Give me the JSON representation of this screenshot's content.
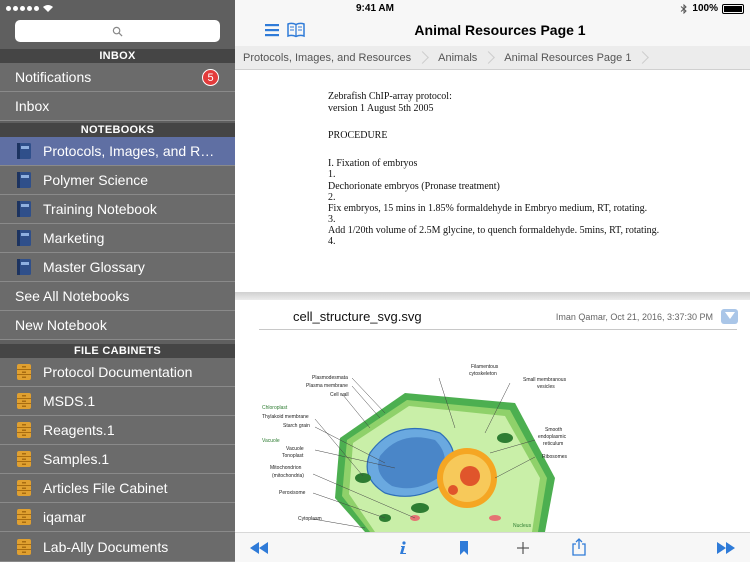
{
  "status": {
    "time": "9:41 AM",
    "battery": "100%"
  },
  "sidebar": {
    "inbox_header": "INBOX",
    "inbox_items": [
      {
        "label": "Notifications",
        "badge": "5"
      },
      {
        "label": "Inbox"
      }
    ],
    "notebooks_header": "NOTEBOOKS",
    "notebooks": [
      {
        "label": "Protocols, Images, and Resources",
        "selected": true
      },
      {
        "label": "Polymer Science"
      },
      {
        "label": "Training Notebook"
      },
      {
        "label": "Marketing"
      },
      {
        "label": "Master Glossary"
      }
    ],
    "notebook_actions": [
      "See All Notebooks",
      "New Notebook"
    ],
    "file_cabinets_header": "FILE CABINETS",
    "file_cabinets": [
      "Protocol Documentation",
      "MSDS.1",
      "Reagents.1",
      "Samples.1",
      "Articles File Cabinet",
      "iqamar",
      "Lab-Ally Documents"
    ]
  },
  "header": {
    "title": "Animal Resources Page 1"
  },
  "breadcrumb": [
    "Protocols, Images, and Resources",
    "Animals",
    "Animal Resources Page 1"
  ],
  "document": {
    "lines": [
      "Zebrafish ChIP-array protocol:",
      "version 1 August 5th 2005",
      "PROCEDURE",
      "I. Fixation of embryos",
      "1.",
      "Dechorionate embryos (Pronase treatment)",
      "2.",
      "Fix embryos, 15 mins in 1.85% formaldehyde in Embryo medium, RT, rotating.",
      "3.",
      "Add 1/20th volume of 2.5M glycine, to quench formaldehyde. 5mins, RT, rotating.",
      "4."
    ]
  },
  "attachment": {
    "filename": "cell_structure_svg.svg",
    "meta": "Iman Qamar, Oct 21, 2016, 3:37:30 PM",
    "figure_labels": {
      "plasmodesmata": "Plasmodesmata",
      "plasma_membrane": "Plasma membrane",
      "cell_wall": "Cell wall",
      "chloroplast": "Chloroplast",
      "thylakoid": "Thylakoid membrane",
      "starch": "Starch grain",
      "vacuole": "Vacuole",
      "vacuole_sub": "Vacuole",
      "tonoplast": "Tonoplast",
      "mitochondrion": "Mitochondrion",
      "mitochondria": "(mitochondria)",
      "peroxisome": "Peroxisome",
      "cytoplasm": "Cytoplasm",
      "filamentous": "Filamentous",
      "cytoskeleton": "cytoskeleton",
      "small_membranous": "Small membranous",
      "vesicles": "vesicles",
      "smooth": "Smooth",
      "endoplasmic": "endoplasmic",
      "reticulum": "reticulum",
      "ribosomes": "Ribosomes",
      "nucleus": "Nucleus"
    }
  },
  "colors": {
    "accent": "#2f7bd8",
    "sidebar": "#6b6b6b",
    "selected": "#5f6fa3",
    "badge": "#e33b3b"
  },
  "icons": {
    "notebook": "notebook-icon",
    "cabinet": "file-cabinet-icon",
    "toolbar": [
      "rewind-icon",
      "info-icon",
      "bookmark-icon",
      "plus-icon",
      "share-icon",
      "forward-icon"
    ]
  }
}
